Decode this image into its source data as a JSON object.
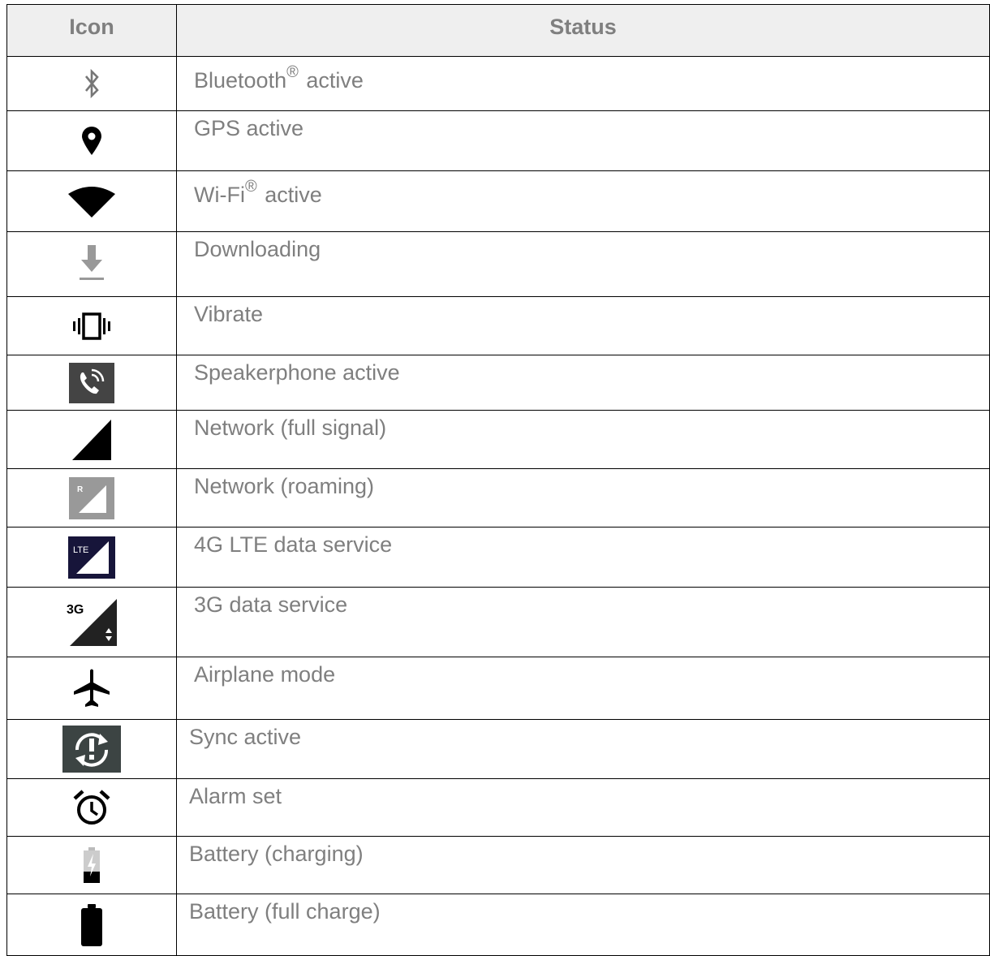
{
  "table": {
    "headers": {
      "icon": "Icon",
      "status": "Status"
    },
    "rows": [
      {
        "icon": "bluetooth-icon",
        "label": "Bluetooth",
        "reg": "®",
        "suffix": " active"
      },
      {
        "icon": "location-pin-icon",
        "label": "GPS active"
      },
      {
        "icon": "wifi-icon",
        "label": "Wi-Fi",
        "reg": "®",
        "suffix": " active"
      },
      {
        "icon": "download-icon",
        "label": "Downloading"
      },
      {
        "icon": "vibrate-icon",
        "label": "Vibrate"
      },
      {
        "icon": "speakerphone-icon",
        "label": "Speakerphone active"
      },
      {
        "icon": "signal-full-icon",
        "label": "Network (full signal)"
      },
      {
        "icon": "signal-roaming-icon",
        "label": "Network (roaming)",
        "icon_text": "R"
      },
      {
        "icon": "lte-icon",
        "label": "4G LTE data service",
        "icon_text": "LTE"
      },
      {
        "icon": "3g-icon",
        "label": "3G data service",
        "icon_text": "3G"
      },
      {
        "icon": "airplane-icon",
        "label": "Airplane mode"
      },
      {
        "icon": "sync-icon",
        "label": "Sync active"
      },
      {
        "icon": "alarm-icon",
        "label": "Alarm set"
      },
      {
        "icon": "battery-charging-icon",
        "label": "Battery (charging)"
      },
      {
        "icon": "battery-full-icon",
        "label": "Battery (full charge)"
      }
    ]
  }
}
